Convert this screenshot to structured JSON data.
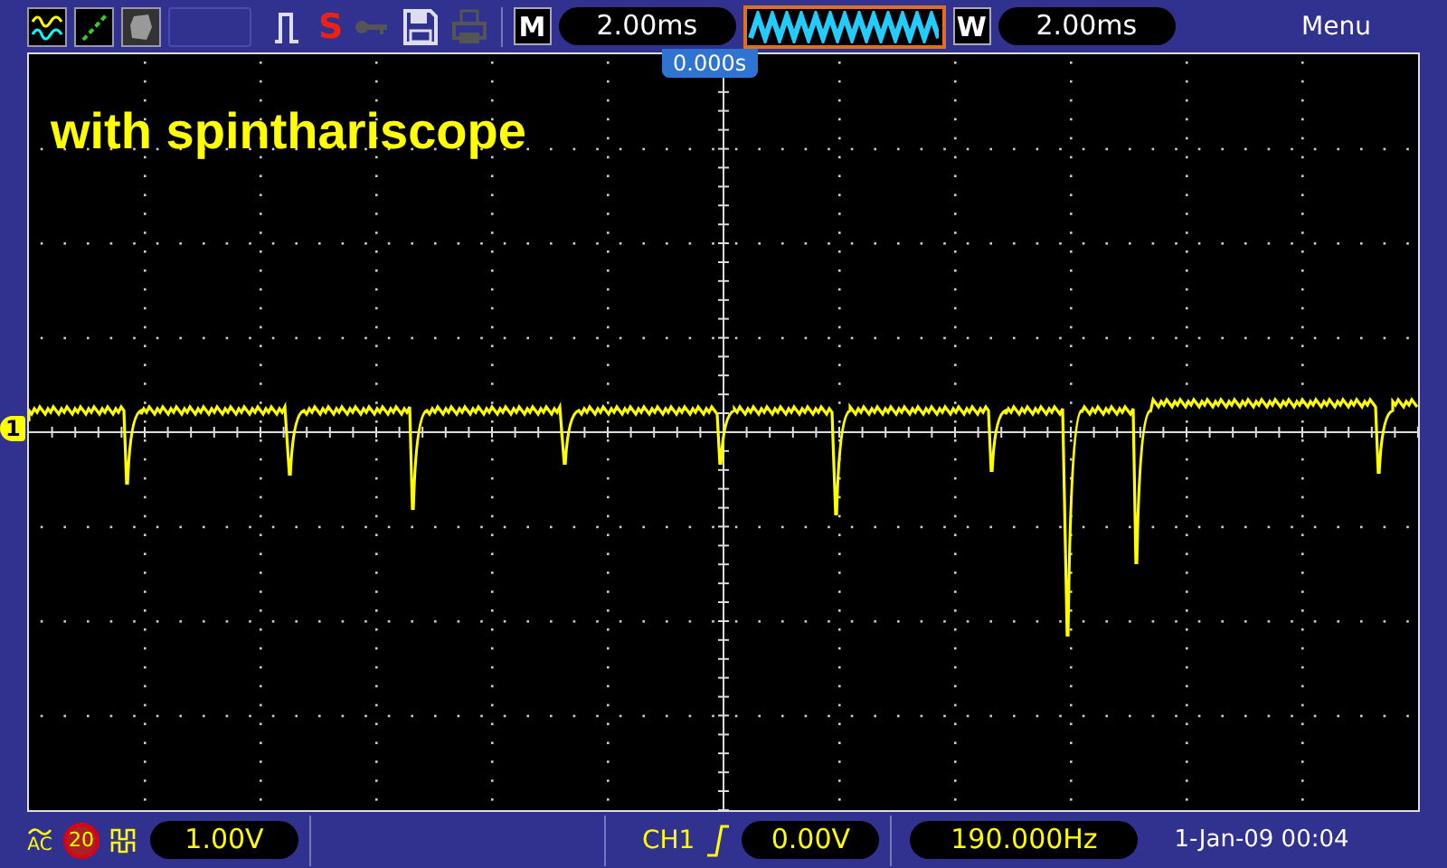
{
  "toolbar": {
    "status_icons": [
      {
        "kind": "pulse",
        "disabled": false
      },
      {
        "kind": "key",
        "disabled": true
      },
      {
        "kind": "floppy",
        "disabled": false
      },
      {
        "kind": "printer",
        "disabled": true
      }
    ],
    "save_mark": "S",
    "main_timebase": {
      "label": "M",
      "value": "2.00ms"
    },
    "window_timebase": {
      "label": "W",
      "value": "2.00ms"
    },
    "menu": "Menu"
  },
  "screen": {
    "trigger_position": "0.000s",
    "channel_marker": "1",
    "annotation": "with spinthariscope"
  },
  "status_bar": {
    "coupling": "AC",
    "bandwidth_limit": "20",
    "volts_per_div": "1.00V",
    "trigger_source": "CH1",
    "trigger_level": "0.00V",
    "frequency": "190.000Hz",
    "datetime": "1-Jan-09 00:04"
  }
}
